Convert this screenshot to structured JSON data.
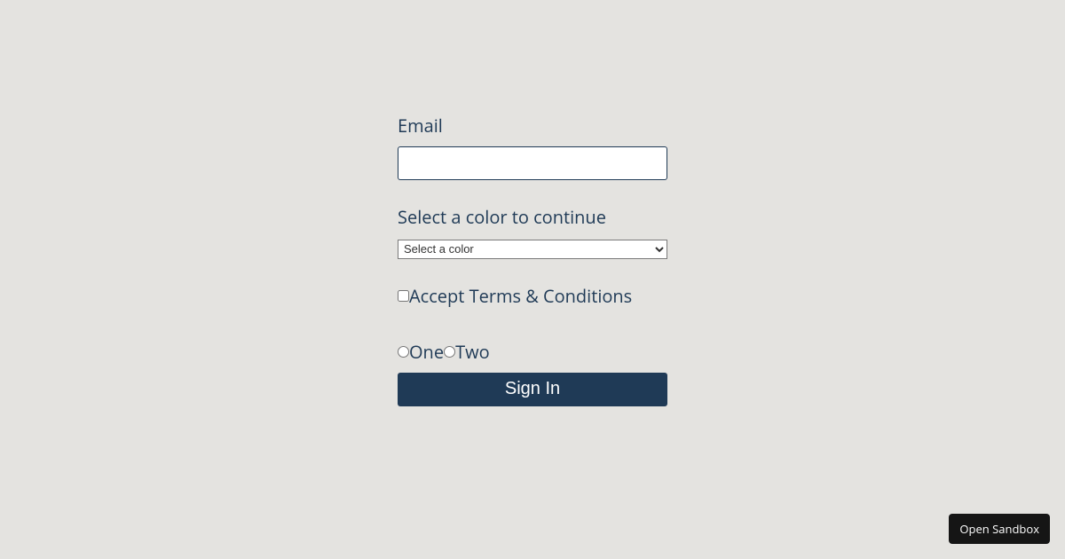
{
  "form": {
    "email": {
      "label": "Email",
      "value": ""
    },
    "color": {
      "label": "Select a color to continue",
      "placeholder": "Select a color"
    },
    "terms": {
      "label": "Accept Terms & Conditions"
    },
    "radio": {
      "options": [
        {
          "label": "One"
        },
        {
          "label": "Two"
        }
      ]
    },
    "submit_label": "Sign In"
  },
  "sandbox_button": "Open Sandbox",
  "colors": {
    "primary": "#1f3a56",
    "background": "#e4e3e0"
  }
}
